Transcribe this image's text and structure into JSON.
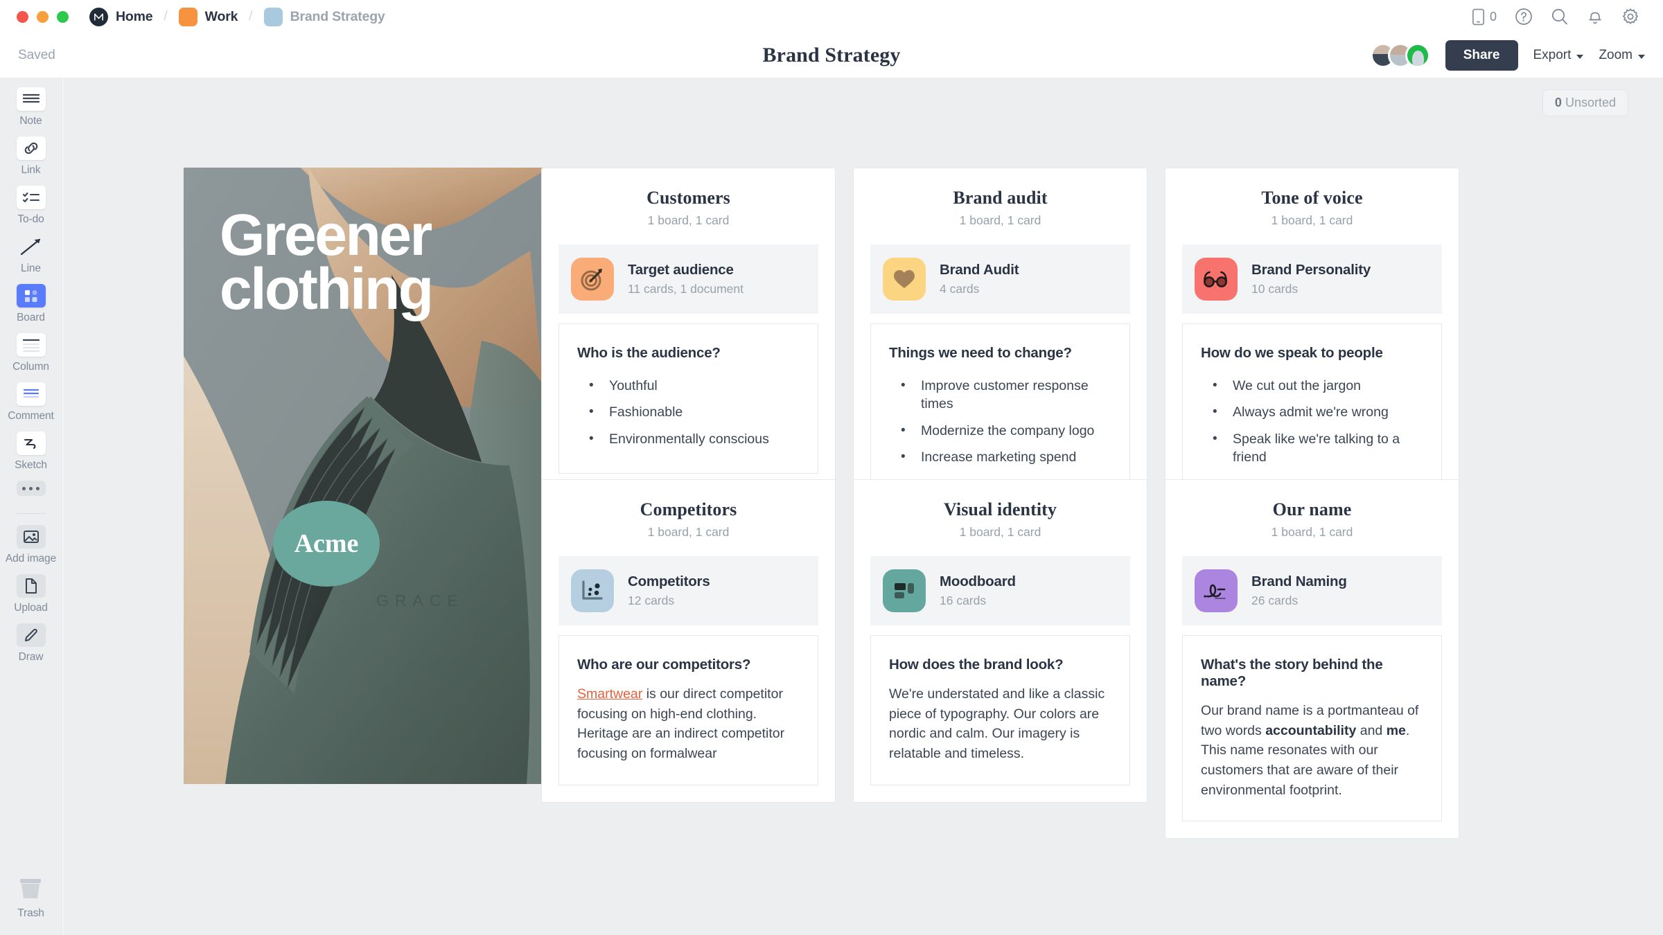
{
  "topbar": {
    "breadcrumbs": [
      {
        "label": "Home",
        "icon": "milanote-logo-icon",
        "kind": "logo"
      },
      {
        "label": "Work",
        "icon": "folder-orange-icon",
        "kind": "orange"
      },
      {
        "label": "Brand Strategy",
        "icon": "board-blue-icon",
        "kind": "blue"
      }
    ],
    "separator": "/",
    "icons": [
      {
        "name": "mobile-icon",
        "count": "0"
      },
      {
        "name": "help-icon"
      },
      {
        "name": "search-icon"
      },
      {
        "name": "notifications-bell-icon"
      },
      {
        "name": "settings-gear-icon"
      }
    ]
  },
  "subbar": {
    "saved_label": "Saved",
    "title": "Brand Strategy",
    "share_label": "Share",
    "export_label": "Export",
    "zoom_label": "Zoom"
  },
  "rail": {
    "tools": [
      {
        "label": "Note",
        "icon": "note-icon"
      },
      {
        "label": "Link",
        "icon": "link-icon"
      },
      {
        "label": "To-do",
        "icon": "todo-icon"
      },
      {
        "label": "Line",
        "icon": "line-arrow-icon"
      },
      {
        "label": "Board",
        "icon": "board-icon",
        "active": true
      },
      {
        "label": "Column",
        "icon": "column-icon"
      },
      {
        "label": "Comment",
        "icon": "comment-icon"
      },
      {
        "label": "Sketch",
        "icon": "sketch-icon"
      }
    ],
    "more_label": "more-options-icon",
    "media": [
      {
        "label": "Add image",
        "icon": "add-image-icon"
      },
      {
        "label": "Upload",
        "icon": "upload-file-icon"
      },
      {
        "label": "Draw",
        "icon": "draw-pencil-icon"
      }
    ],
    "trash_label": "Trash",
    "trash_icon": "trash-icon"
  },
  "canvas": {
    "unsorted_count": "0",
    "unsorted_label": "Unsorted",
    "hero": {
      "title_line1": "Greener",
      "title_line2": "clothing",
      "badge": "Acme",
      "alt": "photo-green-sweater-collar"
    },
    "sections": [
      {
        "title": "Customers",
        "subtitle": "1 board, 1 card",
        "board": {
          "name": "Target audience",
          "meta": "11 cards, 1 document",
          "icon": "target-dart-icon",
          "color": "#f9ac77"
        },
        "note": {
          "heading": "Who is the audience?",
          "type": "list",
          "items": [
            "Youthful",
            "Fashionable",
            "Environmentally conscious"
          ]
        }
      },
      {
        "title": "Brand audit",
        "subtitle": "1 board, 1 card",
        "board": {
          "name": "Brand Audit",
          "meta": "4 cards",
          "icon": "heart-icon",
          "color": "#fbd581"
        },
        "note": {
          "heading": "Things we need to change?",
          "type": "list",
          "items": [
            "Improve customer response times",
            "Modernize the company logo",
            "Increase marketing spend"
          ]
        }
      },
      {
        "title": "Tone of voice",
        "subtitle": "1 board, 1 card",
        "board": {
          "name": "Brand Personality",
          "meta": "10 cards",
          "icon": "glasses-icon",
          "color": "#f9736e"
        },
        "note": {
          "heading": "How do we speak to people",
          "type": "list",
          "items": [
            "We cut out the jargon",
            "Always admit we're wrong",
            "Speak like we're talking to a friend"
          ]
        }
      },
      {
        "title": "Competitors",
        "subtitle": "1 board, 1 card",
        "board": {
          "name": "Competitors",
          "meta": "12 cards",
          "icon": "scatter-chart-icon",
          "color": "#b6cfe0"
        },
        "note": {
          "heading": "Who are our competitors?",
          "type": "paragraph",
          "link_text": "Smartwear",
          "text_after_link": " is our direct competitor focusing on high-end clothing. Heritage are an indirect competitor focusing on formalwear"
        }
      },
      {
        "title": "Visual identity",
        "subtitle": "1 board, 1 card",
        "board": {
          "name": "Moodboard",
          "meta": "16 cards",
          "icon": "moodboard-layout-icon",
          "color": "#64a79f"
        },
        "note": {
          "heading": "How does the brand look?",
          "type": "paragraph",
          "text": "We're understated and like a classic piece of typography. Our colors are nordic and calm. Our imagery is relatable and timeless."
        }
      },
      {
        "title": "Our name",
        "subtitle": "1 board, 1 card",
        "board": {
          "name": "Brand Naming",
          "meta": "26 cards",
          "icon": "signature-icon",
          "color": "#ab85e0"
        },
        "note": {
          "heading": "What's the story behind the name?",
          "type": "rich",
          "part1": "Our brand name is a portmanteau of two words ",
          "bold1": "accountability",
          "part2": " and ",
          "bold2": "me",
          "part3": ". This name resonates with our customers that are aware of their environmental footprint."
        }
      }
    ]
  }
}
